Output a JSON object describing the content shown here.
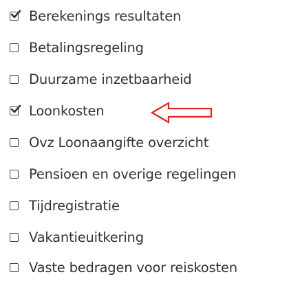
{
  "checklist": {
    "items": [
      {
        "label": "Berekenings resultaten",
        "checked": true
      },
      {
        "label": "Betalingsregeling",
        "checked": false
      },
      {
        "label": "Duurzame inzetbaarheid",
        "checked": false
      },
      {
        "label": "Loonkosten",
        "checked": true
      },
      {
        "label": "Ovz Loonaangifte overzicht",
        "checked": false
      },
      {
        "label": "Pensioen en overige regelingen",
        "checked": false
      },
      {
        "label": "Tijdregistratie",
        "checked": false
      },
      {
        "label": "Vakantieuitkering",
        "checked": false
      },
      {
        "label": "Vaste bedragen voor reiskosten",
        "checked": false
      }
    ]
  },
  "annotation": {
    "arrow_icon": "left-arrow-outline-icon",
    "color": "#e02020"
  }
}
